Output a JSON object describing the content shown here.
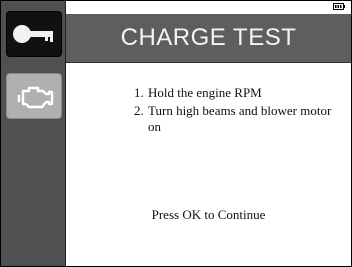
{
  "header": {
    "title": "CHARGE TEST"
  },
  "sidebar": {
    "tabs": [
      {
        "icon": "key-icon",
        "active": true
      },
      {
        "icon": "engine-icon",
        "active": false
      }
    ]
  },
  "status": {
    "battery_icon": "battery-icon"
  },
  "instructions": {
    "steps": [
      {
        "number": "1.",
        "text": "Hold the engine RPM"
      },
      {
        "number": "2.",
        "text": "Turn high beams and blower motor on"
      }
    ]
  },
  "prompt": "Press OK to Continue",
  "colors": {
    "sidebar": "#505050",
    "header": "#5e5e5e",
    "active_tab": "#111111",
    "inactive_tab": "#b0b0b0"
  }
}
